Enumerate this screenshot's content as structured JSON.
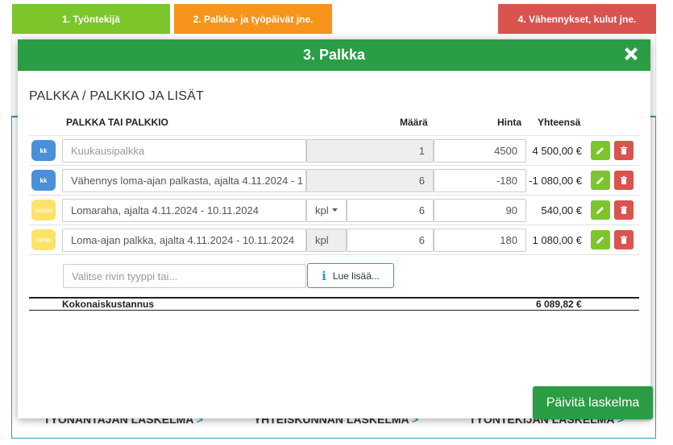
{
  "steps": {
    "step1": "1. Työntekijä",
    "step2": "2. Palkka- ja työpäivät jne.",
    "step4": "4. Vähennykset, kulut jne."
  },
  "background_links": {
    "employer": "TYÖNANTAJAN LASKELMA",
    "society": "YHTEISKUNNAN LASKELMA",
    "employee": "TYÖNTEKIJÄN LASKELMA",
    "arrow": ">"
  },
  "modal": {
    "title": "3. Palkka",
    "close_icon": "close-icon",
    "section_title": "PALKKA / PALKKIO JA LISÄT",
    "headers": {
      "name": "PALKKA TAI PALKKIO",
      "quantity": "Määrä",
      "price": "Hinta",
      "total": "Yhteensä"
    },
    "rows": [
      {
        "badge": "kk",
        "badge_color": "#4a90d9",
        "description": "Kuukausipalkka",
        "quantity": "1",
        "price": "4500",
        "total": "4 500,00 €"
      },
      {
        "badge": "kk",
        "badge_color": "#4a90d9",
        "description": "Vähennys loma-ajan palkasta, ajalta  4.11.2024 -  1",
        "quantity": "6",
        "price": "-180",
        "total": "-1 080,00 €"
      },
      {
        "badge": "bonus",
        "badge_color": "#fde26a",
        "description": "Lomaraha, ajalta  4.11.2024 -  10.11.2024",
        "unit": "kpl",
        "quantity": "6",
        "price": "90",
        "total": "540,00 €"
      },
      {
        "badge": "loma",
        "badge_color": "#fde26a",
        "description": "Loma-ajan palkka, ajalta  4.11.2024 -  10.11.2024",
        "unit": "kpl",
        "quantity": "6",
        "price": "180",
        "total": "1 080,00 €"
      }
    ],
    "type_placeholder": "Valitse rivin tyyppi tai...",
    "read_more": "Lue lisää...",
    "total_label": "Kokonaiskustannus",
    "total_value": "6 089,82 €"
  },
  "update_button": "Päivitä laskelma",
  "colors": {
    "header_green": "#2a9d45",
    "step1": "#7cc52b",
    "step2": "#f7941d",
    "step4": "#d9534f",
    "accent_blue": "#2a9bc3"
  }
}
